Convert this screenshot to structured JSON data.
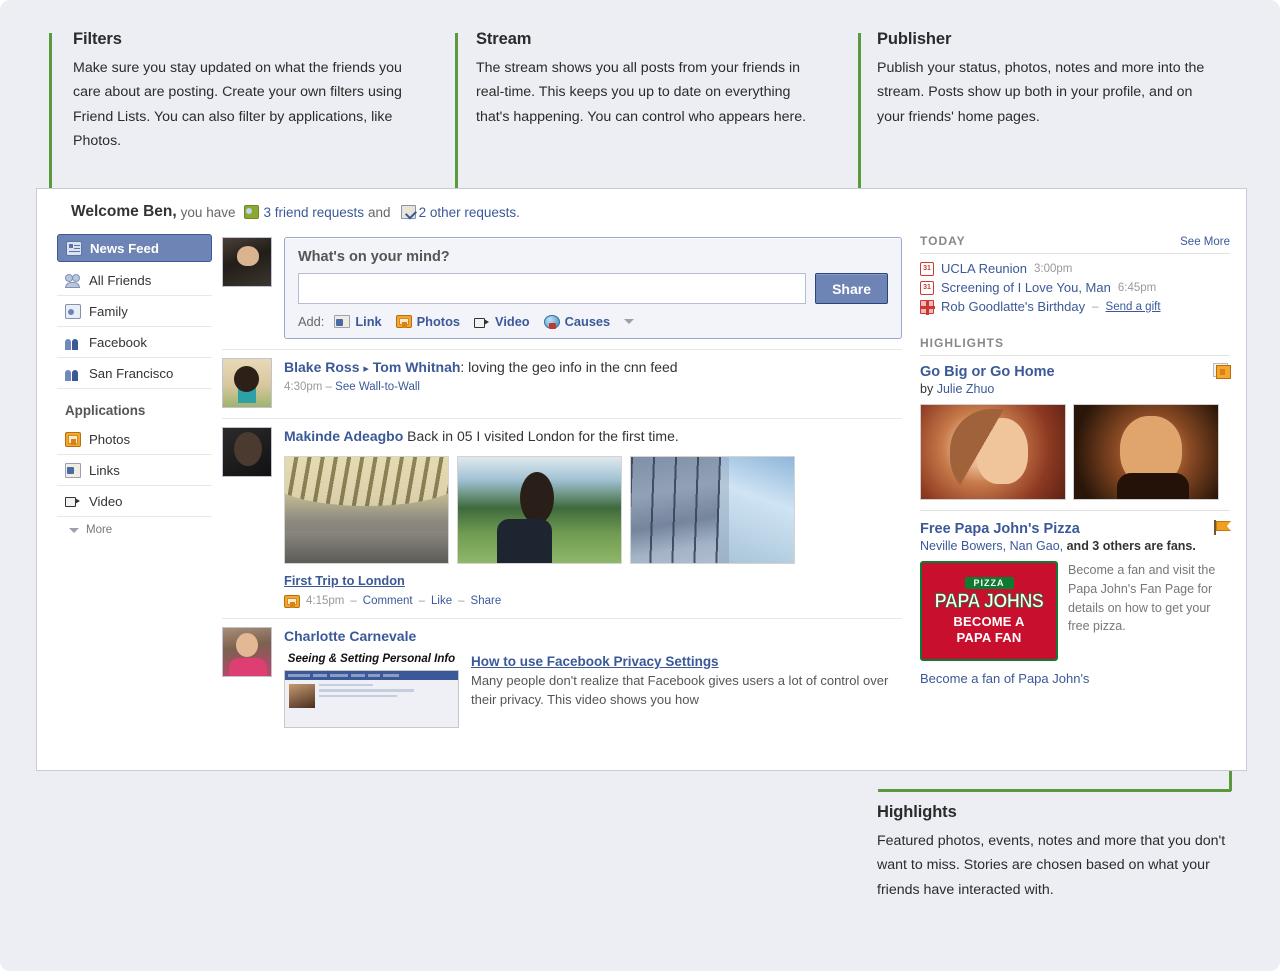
{
  "theme": {
    "page_bg": "#eceef4",
    "accent_blue": "#3b5998",
    "annotation_green": "#5a9a3c",
    "marker_green": "#6eb33f"
  },
  "callouts": [
    {
      "title": "Filters",
      "body": "Make sure you stay updated on what the friends you care about are posting. Create your own filters using Friend Lists. You can also filter by applications, like Photos."
    },
    {
      "title": "Stream",
      "body": "The stream shows you all posts from your friends in real-time. This keeps you up to date on everything that's happening. You can control who appears here."
    },
    {
      "title": "Publisher",
      "body": "Publish your status, photos, notes and more into the stream. Posts show up both in your profile, and on your friends' home pages."
    },
    {
      "title": "Highlights",
      "body": "Featured photos, events, notes and more that you don't want to miss. Stories are chosen based on what your friends have interacted with."
    }
  ],
  "welcome": {
    "greeting": "Welcome Ben,",
    "mid1": "you have",
    "friend_requests": "3 friend requests",
    "conj": "and",
    "other_requests": "2 other requests.",
    "friend_icon": "friend-request-icon",
    "other_icon": "other-request-icon"
  },
  "sidebar": {
    "filters": [
      {
        "label": "News Feed",
        "icon": "news-feed-icon",
        "selected": true
      },
      {
        "label": "All Friends",
        "icon": "all-friends-icon",
        "selected": false
      },
      {
        "label": "Family",
        "icon": "family-icon",
        "selected": false
      },
      {
        "label": "Facebook",
        "icon": "friend-list-icon",
        "selected": false
      },
      {
        "label": "San Francisco",
        "icon": "friend-list-icon",
        "selected": false
      }
    ],
    "applications_label": "Applications",
    "applications": [
      {
        "label": "Photos",
        "icon": "photos-icon"
      },
      {
        "label": "Links",
        "icon": "links-icon"
      },
      {
        "label": "Video",
        "icon": "video-icon"
      }
    ],
    "more_label": "More",
    "more_icon": "chevron-down-icon"
  },
  "publisher": {
    "prompt": "What's on your mind?",
    "input_value": "",
    "input_placeholder": "",
    "share_label": "Share",
    "add_label": "Add:",
    "options": [
      {
        "label": "Link",
        "icon": "link-icon"
      },
      {
        "label": "Photos",
        "icon": "photos-icon"
      },
      {
        "label": "Video",
        "icon": "video-icon"
      },
      {
        "label": "Causes",
        "icon": "causes-icon"
      }
    ],
    "more_icon": "chevron-down-icon"
  },
  "stream": [
    {
      "type": "wall_post",
      "author": "Blake Ross",
      "arrow": "▸",
      "target": "Tom Whitnah",
      "text": ": loving the geo info in the cnn feed",
      "time": "4:30pm",
      "sep": "–",
      "action": "See Wall-to-Wall",
      "avatar": "avatar-blake-ross"
    },
    {
      "type": "photo_album",
      "author": "Makinde Adeagbo",
      "text": "Back in 05 I visited London for the first time.",
      "album_title": "First Trip to London",
      "time": "4:15pm",
      "sep1": "–",
      "actions": [
        "Comment",
        "Like",
        "Share"
      ],
      "album_icon": "photos-icon",
      "avatar": "avatar-makinde-adeagbo",
      "photos": [
        "london-train-station",
        "london-park-portrait",
        "london-glass-building"
      ]
    },
    {
      "type": "video_share",
      "author": "Charlotte Carnevale",
      "avatar": "avatar-charlotte-carnevale",
      "video_caption": "Seeing & Setting Personal Info",
      "video_title": "How to use Facebook Privacy Settings",
      "video_desc": "Many people don't realize that Facebook gives users a lot of control over their privacy. This video shows you how"
    }
  ],
  "right_rail": {
    "today": {
      "header": "TODAY",
      "see_more": "See More",
      "events": [
        {
          "icon": "calendar-icon",
          "icon_text": "31",
          "title": "UCLA Reunion",
          "time": "3:00pm"
        },
        {
          "icon": "calendar-icon",
          "icon_text": "31",
          "title": "Screening of I Love You, Man",
          "time": "6:45pm"
        },
        {
          "icon": "gift-icon",
          "icon_text": "",
          "title": "Rob Goodlatte's Birthday",
          "sep": "–",
          "time": "Send a gift"
        }
      ]
    },
    "highlights": {
      "header": "HIGHLIGHTS",
      "items": [
        {
          "title": "Go Big or Go Home",
          "by_prefix": "by",
          "by_name": "Julie Zhuo",
          "badge_icon": "photos-icon",
          "photos": [
            "portrait-woman",
            "portrait-man-glasses"
          ]
        },
        {
          "title": "Free Papa John's Pizza",
          "fans_names": "Neville Bowers, Nan Gao,",
          "fans_and": "and 3 others",
          "fans_suffix": "are fans.",
          "badge_icon": "page-flag-icon",
          "logo": {
            "pizza_word": "PIZZA",
            "brand": "PAPA JOHNS",
            "cta_line1": "BECOME A",
            "cta_line2": "PAPA FAN"
          },
          "description": "Become a fan and visit the Papa John's Fan Page for details on how to get your free pizza.",
          "fan_link": "Become a fan of Papa John's"
        }
      ]
    }
  }
}
